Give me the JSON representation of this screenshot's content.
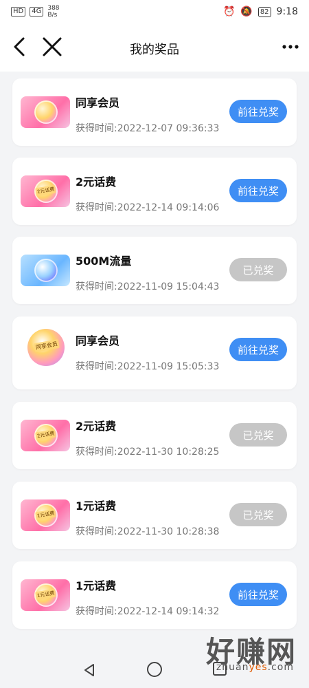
{
  "status_bar": {
    "left_badges": [
      "HD",
      "4G"
    ],
    "net_speed": "388\nB/s",
    "battery": "82",
    "time": "9:18"
  },
  "header": {
    "title": "我的奖品",
    "back_icon": "chevron-left-icon",
    "close_icon": "close-icon",
    "more_icon": "more-horizontal-icon"
  },
  "prizes": [
    {
      "name": "同享会员",
      "time_label": "获得时间:2022-12-07 09:36:33",
      "button": "前往兑奖",
      "state": "go",
      "thumb": "pink",
      "tag": ""
    },
    {
      "name": "2元话费",
      "time_label": "获得时间:2022-12-14 09:14:06",
      "button": "前往兑奖",
      "state": "go",
      "thumb": "pink",
      "tag": "2元话费"
    },
    {
      "name": "500M流量",
      "time_label": "获得时间:2022-11-09 15:04:43",
      "button": "已兑奖",
      "state": "done",
      "thumb": "blue",
      "tag": ""
    },
    {
      "name": "同享会员",
      "time_label": "获得时间:2022-11-09 15:05:33",
      "button": "前往兑奖",
      "state": "go",
      "thumb": "round",
      "tag": "同享会员"
    },
    {
      "name": "2元话费",
      "time_label": "获得时间:2022-11-30 10:28:25",
      "button": "已兑奖",
      "state": "done",
      "thumb": "pink",
      "tag": "2元话费"
    },
    {
      "name": "1元话费",
      "time_label": "获得时间:2022-11-30 10:28:38",
      "button": "已兑奖",
      "state": "done",
      "thumb": "pink",
      "tag": "1元话费"
    },
    {
      "name": "1元话费",
      "time_label": "获得时间:2022-12-14 09:14:32",
      "button": "前往兑奖",
      "state": "go",
      "thumb": "pink",
      "tag": "1元话费"
    }
  ],
  "bottom_nav": {
    "back_icon": "triangle-back-icon",
    "home_icon": "circle-home-icon",
    "recents_icon": "square-recents-icon"
  },
  "watermark": {
    "title": "好赚网",
    "url_prefix": "zhuan",
    "url_highlight": "yes",
    "url_suffix": ".com"
  },
  "colors": {
    "go_button": "#3f8ef4",
    "done_button": "#c6c6c6"
  }
}
